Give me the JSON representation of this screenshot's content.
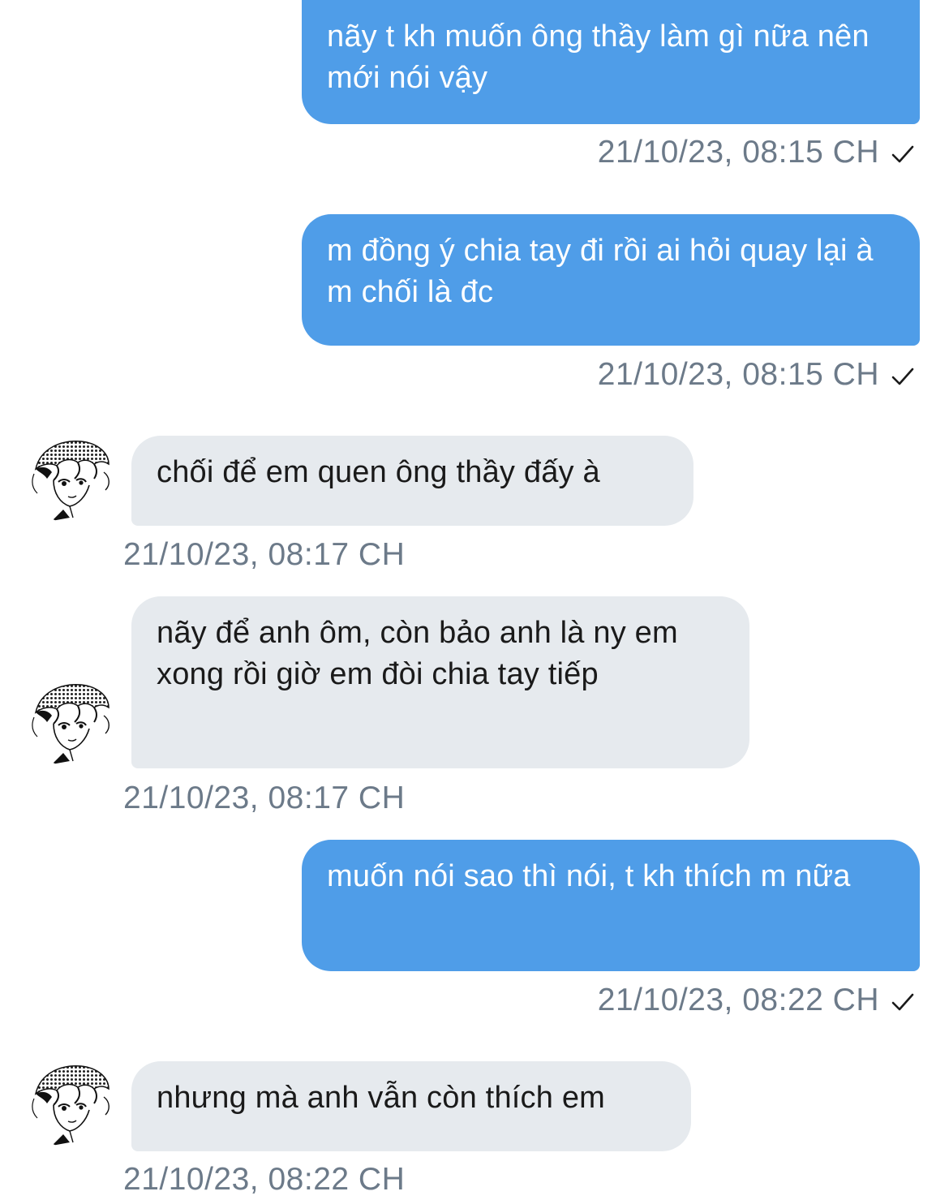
{
  "messages": [
    {
      "direction": "out",
      "text": "nãy t kh muốn ông thầy làm gì nữa nên mới nói vậy",
      "time": "21/10/23, 08:15 CH",
      "status_icon": "checkmark-icon"
    },
    {
      "direction": "out",
      "text": "m đồng ý chia tay đi rồi ai hỏi quay lại à m chối là đc",
      "time": "21/10/23, 08:15 CH",
      "status_icon": "checkmark-icon"
    },
    {
      "direction": "in",
      "text": "chối để em quen ông thầy đấy à",
      "time": "21/10/23, 08:17 CH",
      "avatar_icon": "manga-avatar-icon"
    },
    {
      "direction": "in",
      "text": "nãy để anh ôm, còn bảo anh là ny em xong rồi giờ em đòi chia tay tiếp",
      "time": "21/10/23, 08:17 CH",
      "avatar_icon": "manga-avatar-icon"
    },
    {
      "direction": "out",
      "text": "muốn nói sao thì nói, t kh thích m nữa",
      "time": "21/10/23, 08:22 CH",
      "status_icon": "checkmark-icon"
    },
    {
      "direction": "in",
      "text": "nhưng mà anh vẫn còn thích em",
      "time": "21/10/23, 08:22 CH",
      "avatar_icon": "manga-avatar-icon"
    }
  ],
  "colors": {
    "outgoing_bubble": "#4f9de8",
    "incoming_bubble": "#e6eaee",
    "timestamp": "#6c7a89",
    "background": "#ffffff"
  }
}
